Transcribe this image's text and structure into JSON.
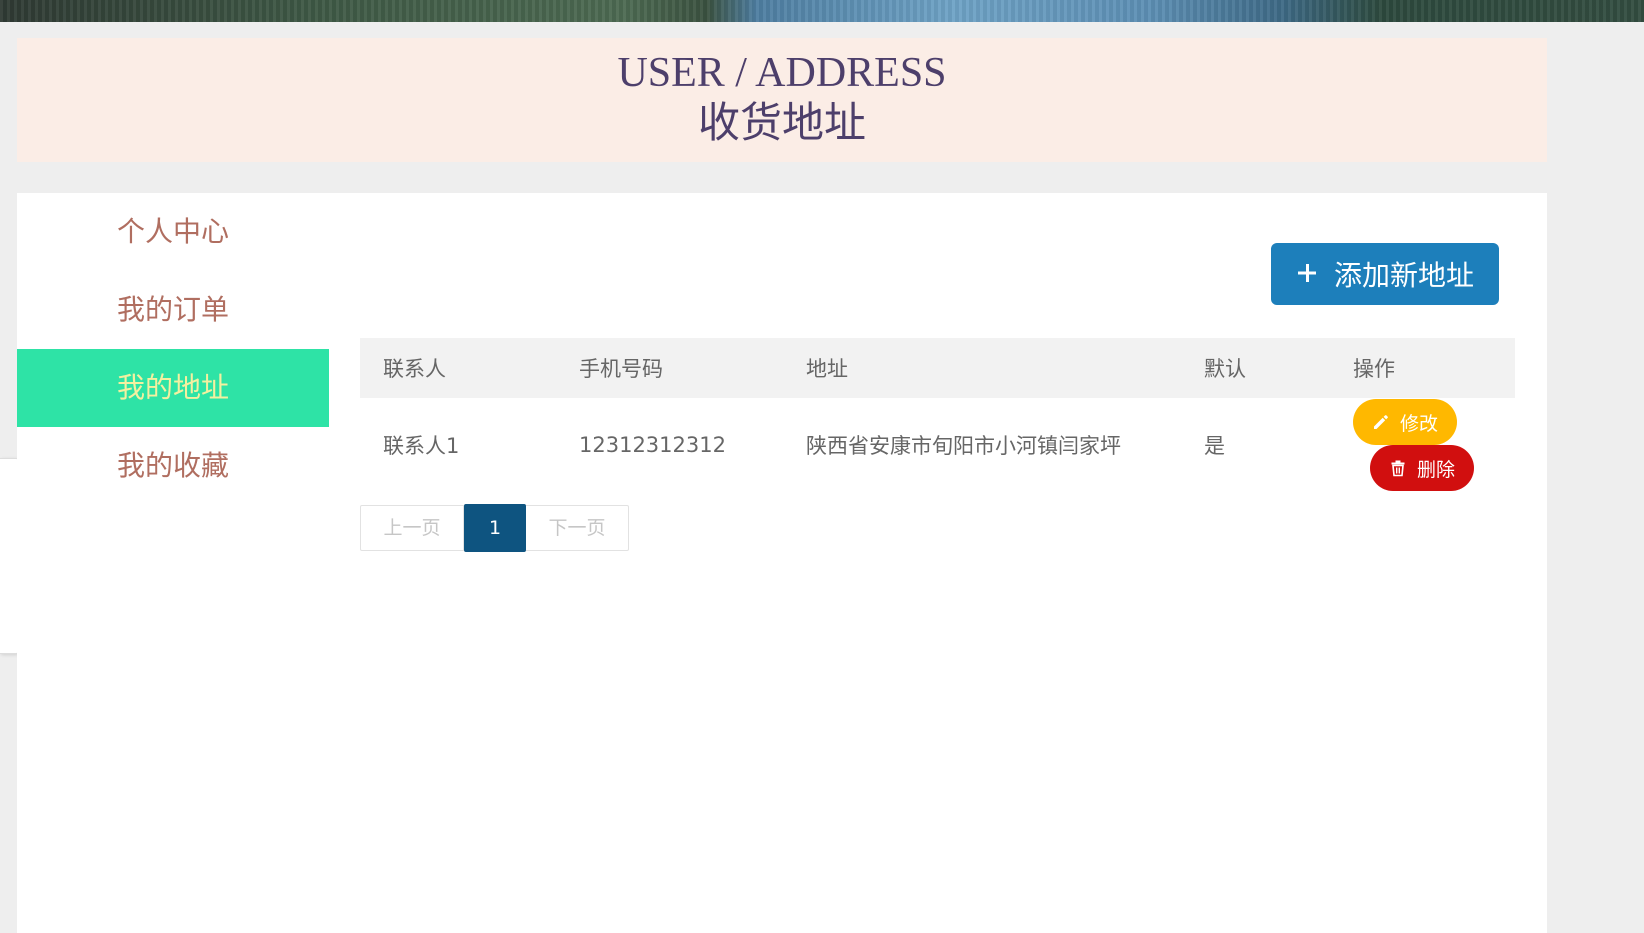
{
  "banner": {
    "title_en": "USER / ADDRESS",
    "title_cn": "收货地址"
  },
  "sidebar": {
    "items": [
      {
        "label": "个人中心",
        "active": false
      },
      {
        "label": "我的订单",
        "active": false
      },
      {
        "label": "我的地址",
        "active": true
      },
      {
        "label": "我的收藏",
        "active": false
      }
    ]
  },
  "toolbar": {
    "add_icon": "plus-icon",
    "add_label": "添加新地址"
  },
  "table": {
    "headers": [
      "联系人",
      "手机号码",
      "地址",
      "默认",
      "操作"
    ],
    "rows": [
      {
        "contact": "联系人1",
        "phone": "12312312312",
        "address": "陕西省安康市旬阳市小河镇闫家坪",
        "default": "是",
        "edit_label": "修改",
        "edit_icon": "pencil-icon",
        "delete_label": "删除",
        "delete_icon": "trash-icon"
      }
    ]
  },
  "pagination": {
    "prev_label": "上一页",
    "current_page": "1",
    "next_label": "下一页"
  },
  "colors": {
    "active_nav_bg": "#2ee3a6",
    "active_nav_text": "#f4f0a0",
    "nav_text": "#b06e60",
    "primary_button": "#1d7fbb",
    "edit_button": "#ffb800",
    "delete_button": "#d10f0f",
    "current_page": "#0e5480",
    "banner_bg": "#fbede6"
  }
}
